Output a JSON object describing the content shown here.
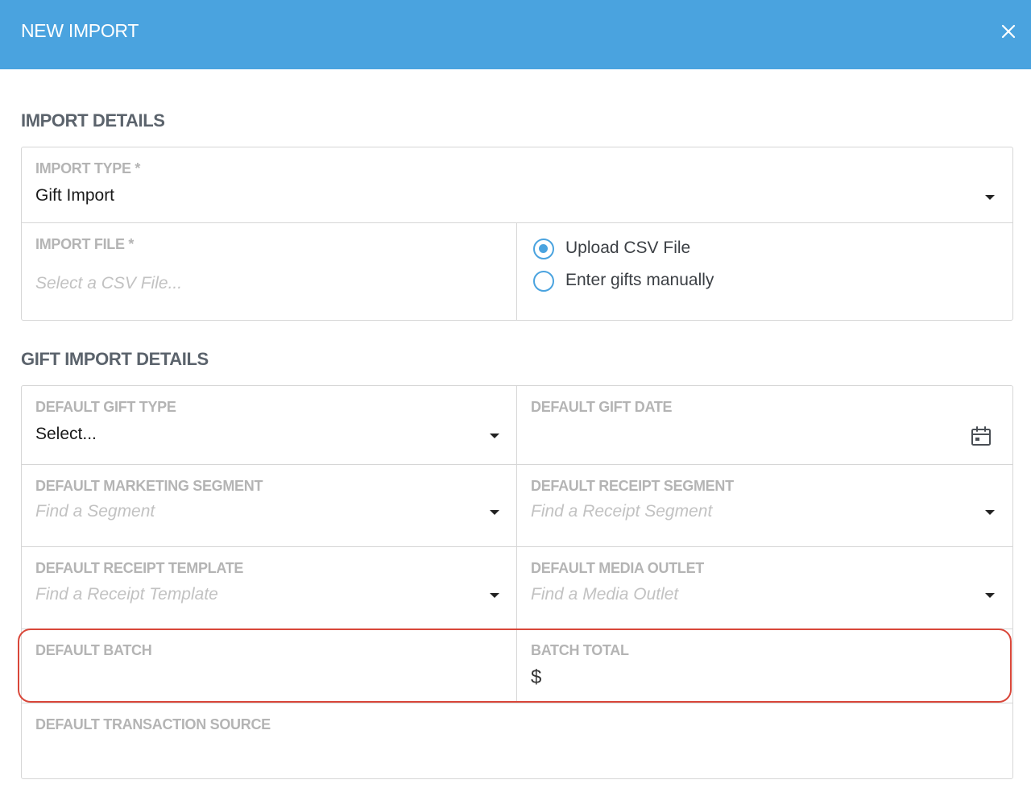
{
  "modal": {
    "title": "NEW IMPORT",
    "close_icon": "close-icon",
    "header_color": "#4aa3df"
  },
  "import_details": {
    "heading": "IMPORT DETAILS",
    "import_type": {
      "label": "IMPORT TYPE *",
      "value": "Gift Import"
    },
    "import_file": {
      "label": "IMPORT FILE *",
      "placeholder": "Select a CSV File..."
    },
    "source_options": [
      {
        "label": "Upload CSV File",
        "checked": true
      },
      {
        "label": "Enter gifts manually",
        "checked": false
      }
    ]
  },
  "gift_import_details": {
    "heading": "GIFT IMPORT DETAILS",
    "default_gift_type": {
      "label": "DEFAULT GIFT TYPE",
      "value": "Select..."
    },
    "default_gift_date": {
      "label": "DEFAULT GIFT DATE",
      "icon": "calendar-icon"
    },
    "default_marketing_segment": {
      "label": "DEFAULT MARKETING SEGMENT",
      "placeholder": "Find a Segment"
    },
    "default_receipt_segment": {
      "label": "DEFAULT RECEIPT SEGMENT",
      "placeholder": "Find a Receipt Segment"
    },
    "default_receipt_template": {
      "label": "DEFAULT RECEIPT TEMPLATE",
      "placeholder": "Find a Receipt Template"
    },
    "default_media_outlet": {
      "label": "DEFAULT MEDIA OUTLET",
      "placeholder": "Find a Media Outlet"
    },
    "default_batch": {
      "label": "DEFAULT BATCH",
      "value": ""
    },
    "batch_total": {
      "label": "BATCH TOTAL",
      "currency": "$",
      "value": ""
    },
    "default_transaction_source": {
      "label": "DEFAULT TRANSACTION SOURCE",
      "value": ""
    }
  },
  "highlight_color": "#d9473a"
}
